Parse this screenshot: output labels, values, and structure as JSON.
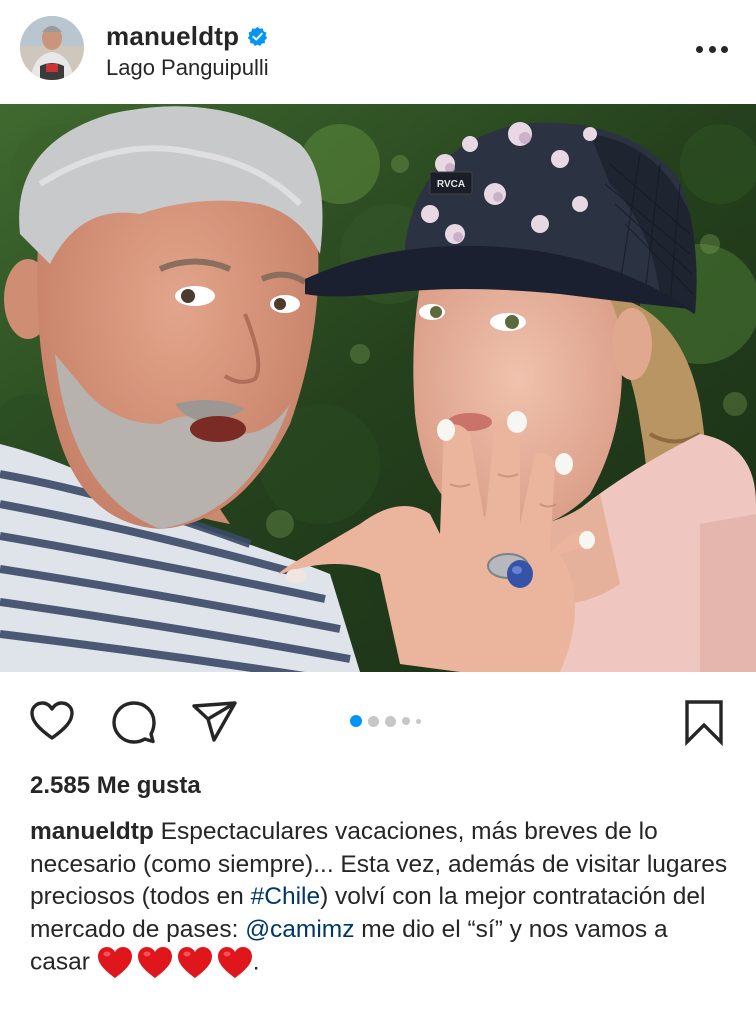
{
  "post": {
    "username": "manueldtp",
    "verified": true,
    "location": "Lago Panguipulli"
  },
  "header": {
    "more_icon": "more-options-icon",
    "verified_icon": "verified-badge-icon"
  },
  "photo": {
    "ring_text": "RVCA"
  },
  "actions": {
    "icons": [
      "heart-icon",
      "comment-icon",
      "share-icon",
      "bookmark-icon"
    ],
    "carousel": {
      "total": 5,
      "active": 1
    },
    "accent": "#0095f6"
  },
  "likes": {
    "text": "2.585 Me gusta"
  },
  "caption": {
    "username": "manueldtp",
    "part1": " Espectaculares vacaciones, más breves de lo necesario (como siempre)... Esta vez, además de visitar lugares preciosos (todos en ",
    "hashtag": "#Chile",
    "part2": ") volví con la mejor contratación del mercado de pases: ",
    "mention": "@camimz",
    "part3": " me dio el “sí” y nos vamos a casar ",
    "hearts": 4,
    "end": ".",
    "link_color": "#00376b",
    "heart_color": "#e0161d"
  }
}
